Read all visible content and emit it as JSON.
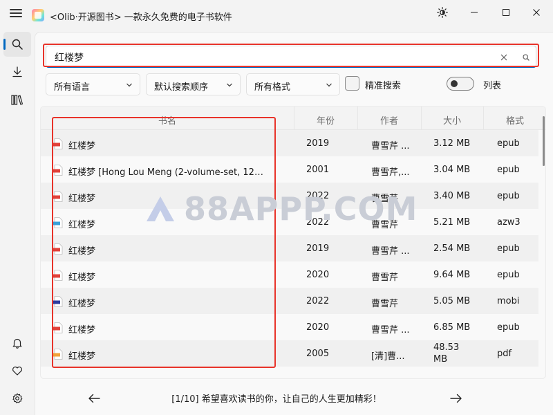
{
  "window": {
    "title": "<Olib·开源图书> 一款永久免费的电子书软件",
    "icons": {
      "theme": "brightness-icon",
      "minimize": "minimize-icon",
      "maximize": "maximize-icon",
      "close": "close-icon"
    }
  },
  "sidebar": {
    "items": [
      {
        "name": "search",
        "icon": "search-icon",
        "active": true
      },
      {
        "name": "downloads",
        "icon": "download-icon",
        "active": false
      },
      {
        "name": "library",
        "icon": "library-icon",
        "active": false
      }
    ],
    "bottom": [
      {
        "name": "notifications",
        "icon": "bell-icon"
      },
      {
        "name": "favorites",
        "icon": "heart-icon"
      },
      {
        "name": "settings",
        "icon": "gear-icon"
      }
    ]
  },
  "search": {
    "value": "红楼梦",
    "placeholder": ""
  },
  "filters": {
    "language": "所有语言",
    "sort": "默认搜索顺序",
    "format": "所有格式",
    "exact_label": "精准搜索",
    "exact_checked": false,
    "list_label": "列表",
    "list_on": false
  },
  "table": {
    "columns": [
      "书名",
      "年份",
      "作者",
      "大小",
      "格式"
    ],
    "rows": [
      {
        "title": "红楼梦",
        "year": "2019",
        "author": "曹雪芹 ...",
        "size": "3.12 MB",
        "format": "epub"
      },
      {
        "title": "红楼梦 [Hong Lou Meng (2-volume-set, 120 ...",
        "year": "2001",
        "author": "曹雪芹,...",
        "size": "3.04 MB",
        "format": "epub"
      },
      {
        "title": "红楼梦",
        "year": "2022",
        "author": "曹雪芹",
        "size": "3.40 MB",
        "format": "epub"
      },
      {
        "title": "红楼梦",
        "year": "2022",
        "author": "曹雪芹",
        "size": "5.21 MB",
        "format": "azw3"
      },
      {
        "title": "红楼梦",
        "year": "2019",
        "author": "曹雪芹 ...",
        "size": "2.54 MB",
        "format": "epub"
      },
      {
        "title": "红楼梦",
        "year": "2020",
        "author": "曹雪芹",
        "size": "9.64 MB",
        "format": "epub"
      },
      {
        "title": "红楼梦",
        "year": "2022",
        "author": "曹雪芹",
        "size": "5.05 MB",
        "format": "mobi"
      },
      {
        "title": "红楼梦",
        "year": "2020",
        "author": "曹雪芹 ...",
        "size": "6.85 MB",
        "format": "epub"
      },
      {
        "title": "红楼梦",
        "year": "2005",
        "author": "[清]曹...",
        "size": "48.53 MB",
        "format": "pdf"
      }
    ]
  },
  "footer": {
    "text": "[1/10] 希望喜欢读书的你，让自己的人生更加精彩！"
  },
  "watermark": {
    "text": "88APPP.COM"
  },
  "colors": {
    "accent": "#0067c0",
    "highlight_red": "#e8332a",
    "epub": "#e0413a",
    "azw3": "#3aa0d8",
    "mobi": "#2b3a9e",
    "pdf": "#f0a23a"
  }
}
